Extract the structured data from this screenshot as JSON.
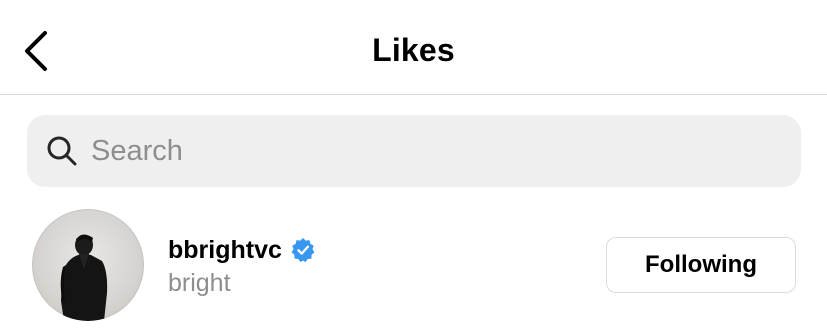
{
  "header": {
    "title": "Likes",
    "back_icon": "chevron-left-icon"
  },
  "search": {
    "placeholder": "Search",
    "value": "",
    "icon": "search-icon"
  },
  "likes": [
    {
      "username": "bbrightvc",
      "full_name": "bright",
      "verified": true,
      "verified_color": "#3897f0",
      "follow_label": "Following"
    }
  ],
  "colors": {
    "divider": "#dbdbdb",
    "search_bg": "#efefef",
    "secondary_text": "#8e8e8e",
    "verified_blue": "#3897f0"
  }
}
